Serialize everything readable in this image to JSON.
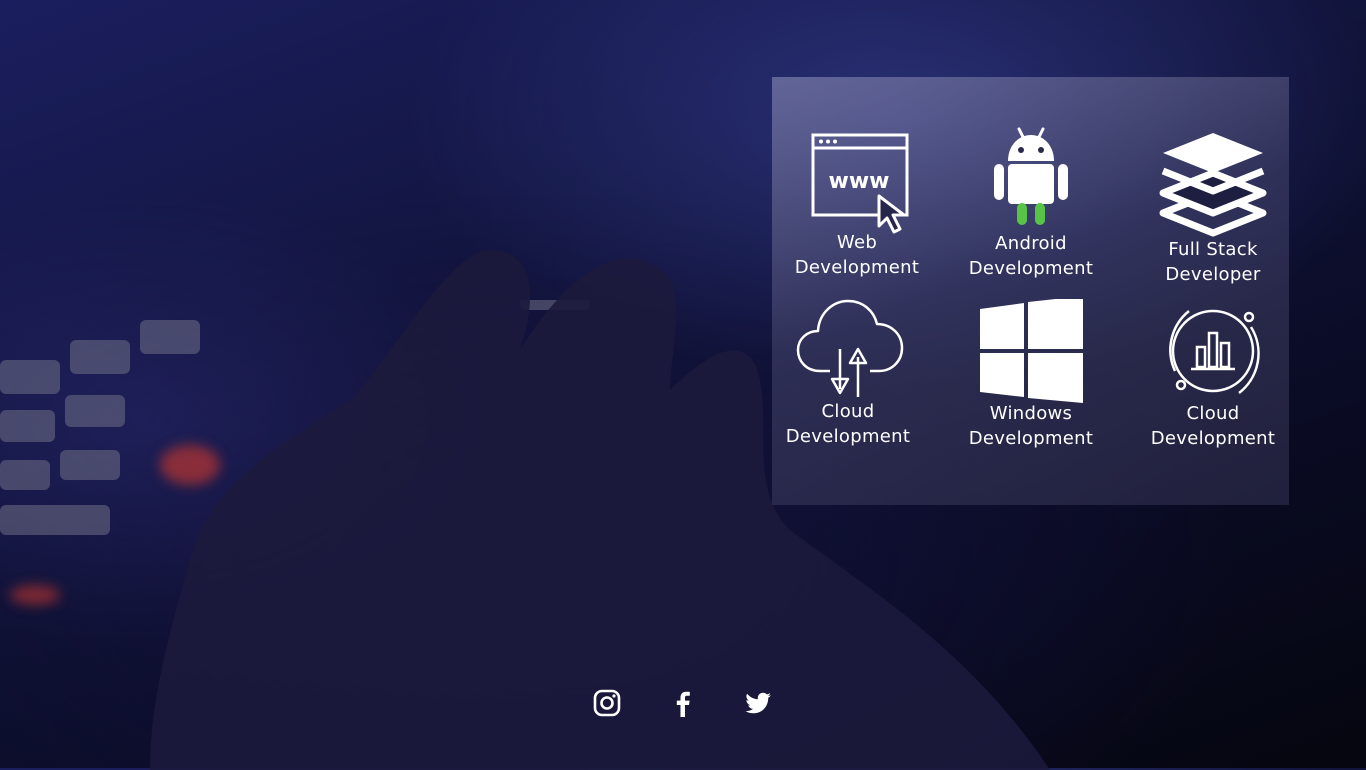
{
  "services": [
    {
      "icon": "web-browser-icon",
      "label_line1": "Web",
      "label_line2": "Development"
    },
    {
      "icon": "android-icon",
      "label_line1": "Android",
      "label_line2": "Development"
    },
    {
      "icon": "layers-stack-icon",
      "label_line1": "Full Stack",
      "label_line2": "Developer"
    },
    {
      "icon": "cloud-transfer-icon",
      "label_line1": "Cloud",
      "label_line2": "Development"
    },
    {
      "icon": "windows-icon",
      "label_line1": "Windows",
      "label_line2": "Development"
    },
    {
      "icon": "cloud-analytics-icon",
      "label_line1": "Cloud",
      "label_line2": "Development"
    }
  ],
  "social": [
    {
      "icon": "instagram-icon"
    },
    {
      "icon": "facebook-icon"
    },
    {
      "icon": "twitter-icon"
    }
  ],
  "colors": {
    "android_legs": "#58c447",
    "panel_text": "#ffffff"
  }
}
